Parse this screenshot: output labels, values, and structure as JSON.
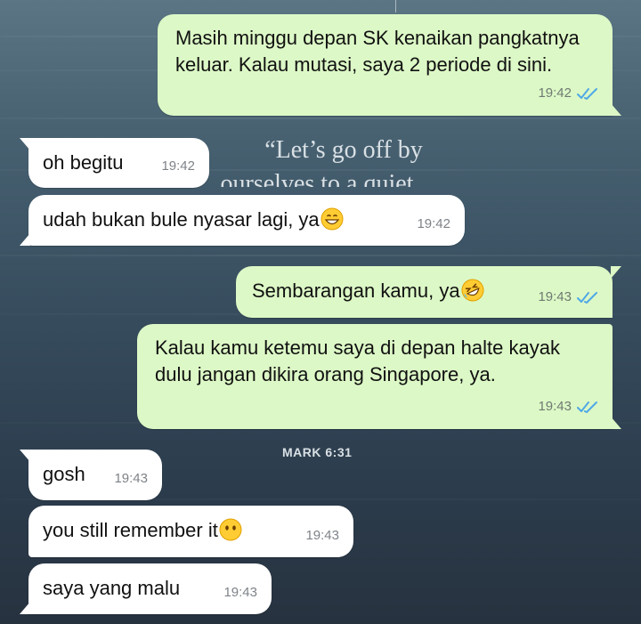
{
  "wallpaper": {
    "quote_line1": "“Let’s go off by",
    "quote_line2": "ourselves to a quiet",
    "verse": "MARK 6:31"
  },
  "messages": [
    {
      "dir": "out",
      "text": "Masih minggu depan SK kenaikan pangkatnya keluar. Kalau mutasi, saya 2 periode di sini.",
      "time": "19:42",
      "status": "read"
    },
    {
      "dir": "in",
      "text": "oh begitu",
      "time": "19:42"
    },
    {
      "dir": "in",
      "text": "udah bukan bule nyasar lagi, ya",
      "emoji": "grinning-face-emoji",
      "time": "19:42"
    },
    {
      "dir": "out",
      "text": "Sembarangan kamu, ya",
      "emoji": "rolling-on-floor-laughing-emoji",
      "time": "19:43",
      "status": "read"
    },
    {
      "dir": "out",
      "text": "Kalau kamu ketemu saya di depan halte kayak dulu jangan dikira orang Singapore, ya.",
      "time": "19:43",
      "status": "read"
    },
    {
      "dir": "in",
      "text": "gosh",
      "time": "19:43"
    },
    {
      "dir": "in",
      "text": "you still remember it",
      "emoji": "face-without-mouth-emoji",
      "time": "19:43"
    },
    {
      "dir": "in",
      "text": "saya yang malu",
      "time": "19:43"
    }
  ],
  "colors": {
    "outgoing_bubble": "#dcf8c6",
    "incoming_bubble": "#ffffff",
    "read_ticks": "#4fa8e6"
  }
}
